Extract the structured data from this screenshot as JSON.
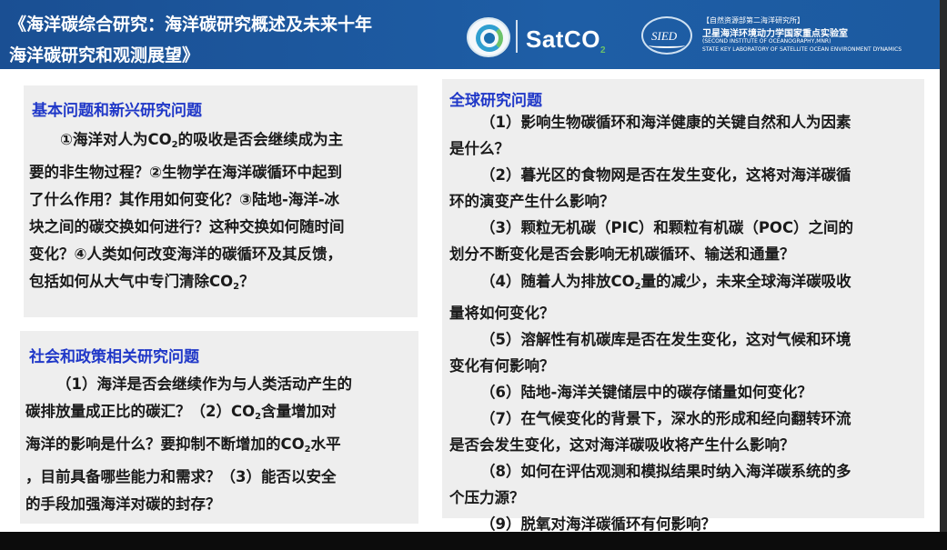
{
  "header": {
    "title_line1": "《海洋碳综合研究：海洋碳研究概述及未来十年",
    "title_line2": "海洋碳研究和观测展望》",
    "brand": "SatCO",
    "brand_suffix": "2",
    "sied_logo": "SIED",
    "institute_line1": "【自然资源部第二海洋研究所】",
    "institute_line2": "卫星海洋环境动力学国家重点实验室",
    "institute_line3": "(SECOND INSTITUTE OF OCEANOGRAPHY,MNR)",
    "institute_line4": "STATE KEY LABORATORY OF SATELLITE OCEAN ENVIRONMENT DYNAMICS"
  },
  "panel1": {
    "title": "基本问题和新兴研究问题",
    "lines": [
      [
        "①海洋对人为CO",
        "2",
        "的吸收是否会继续成为主"
      ],
      [
        "要的非生物过程？②生物学在海洋碳循环中起到"
      ],
      [
        "了什么作用？其作用如何变化？③陆地-海洋-冰"
      ],
      [
        "块之间的碳交换如何进行？这种交换如何随时间"
      ],
      [
        "变化？④人类如何改变海洋的碳循环及其反馈，"
      ],
      [
        "包括如何从大气中专门清除CO",
        "2",
        "？"
      ]
    ]
  },
  "panel2": {
    "title": "社会和政策相关研究问题",
    "lines": [
      [
        "（1）海洋是否会继续作为与人类活动产生的"
      ],
      [
        "碳排放量成正比的碳汇？（2）CO",
        "2",
        "含量增加对"
      ],
      [
        "海洋的影响是什么？要抑制不断增加的CO",
        "2",
        "水平"
      ],
      [
        "，目前具备哪些能力和需求？（3）能否以安全"
      ],
      [
        "的手段加强海洋对碳的封存？"
      ]
    ]
  },
  "panel3": {
    "title": "全球研究问题",
    "lines": [
      [
        "（1）影响生物碳循环和海洋健康的关键自然和人为因素"
      ],
      [
        "是什么？"
      ],
      [
        "（2）暮光区的食物网是否在发生变化，这将对海洋碳循"
      ],
      [
        "环的演变产生什么影响？"
      ],
      [
        "（3）颗粒无机碳（PIC）和颗粒有机碳（POC）之间的"
      ],
      [
        "划分不断变化是否会影响无机碳循环、输送和通量？"
      ],
      [
        "（4）随着人为排放CO",
        "2",
        "量的减少，未来全球海洋碳吸收"
      ],
      [
        "量将如何变化？"
      ],
      [
        "（5）溶解性有机碳库是否在发生变化，这对气候和环境"
      ],
      [
        "变化有何影响？"
      ],
      [
        "（6）陆地-海洋关键储层中的碳存储量如何变化？"
      ],
      [
        "（7）在气候变化的背景下，深水的形成和经向翻转环流"
      ],
      [
        "是否会发生变化，这对海洋碳吸收将产生什么影响？"
      ],
      [
        "（8）如何在评估观测和模拟结果时纳入海洋碳系统的多"
      ],
      [
        "个压力源？"
      ],
      [
        "（9）脱氧对海洋碳循环有何影响？"
      ]
    ]
  }
}
